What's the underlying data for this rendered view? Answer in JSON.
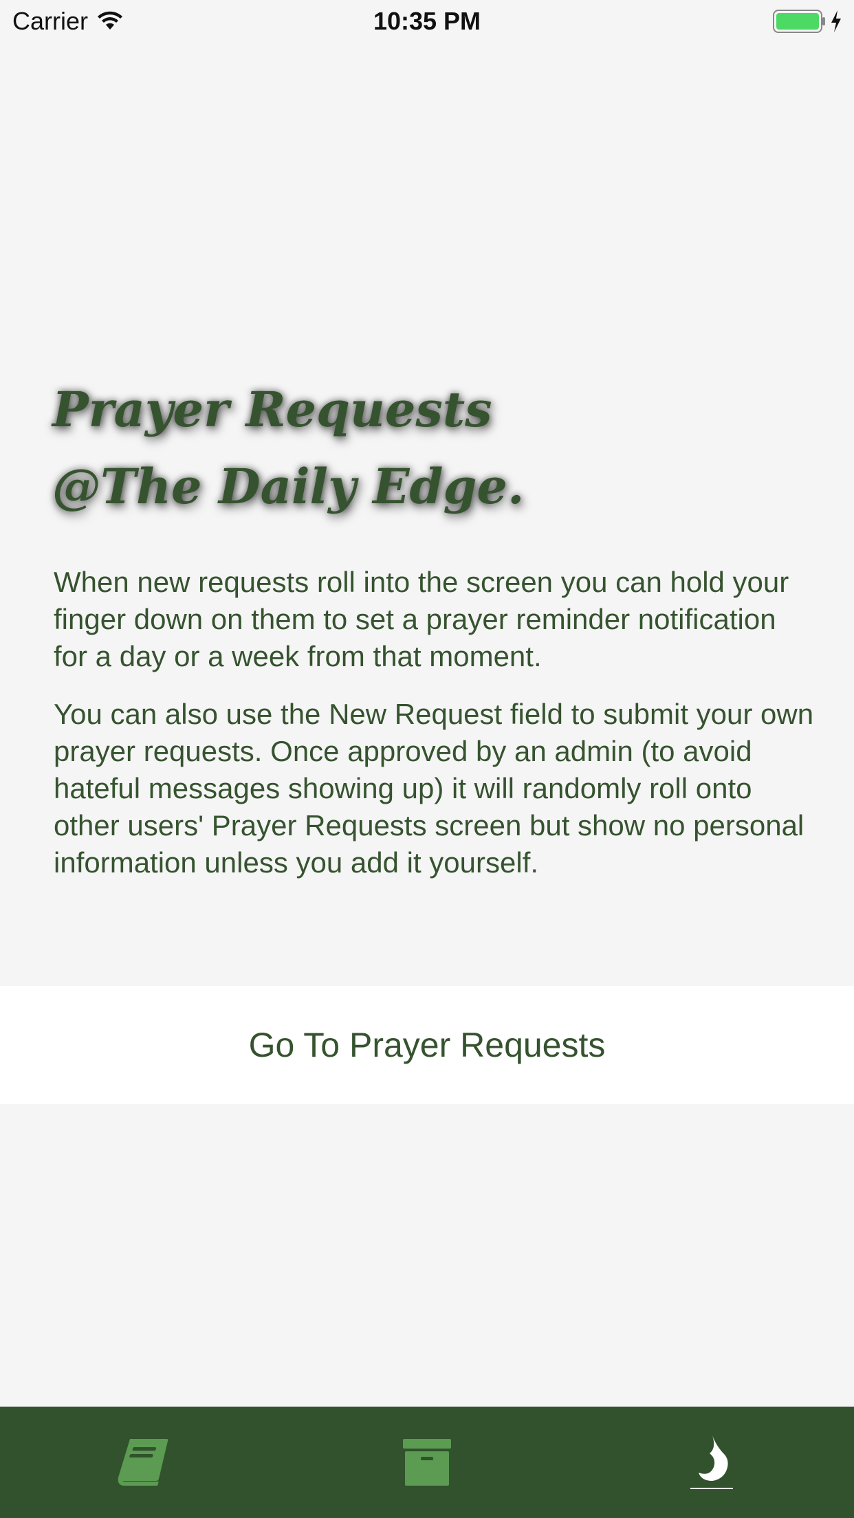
{
  "status_bar": {
    "carrier": "Carrier",
    "time": "10:35 PM",
    "battery_color": "#4cd964"
  },
  "header": {
    "title_line1": "Prayer Requests",
    "title_line2": "@The Daily Edge."
  },
  "body": {
    "paragraph1": "When new requests roll into the screen you can hold your finger down on them to set a prayer reminder notification for a day or a week from that moment.",
    "paragraph2": "You can also use the New Request field to submit your own prayer requests.  Once approved by an admin (to avoid hateful messages showing up) it will randomly roll onto other users' Prayer Requests screen but show no personal information unless you add it yourself."
  },
  "actions": {
    "go_button_label": "Go To Prayer Requests"
  },
  "tab_bar": {
    "background": "#32512d",
    "tabs": [
      {
        "icon": "book-icon",
        "color": "#5b9b52"
      },
      {
        "icon": "archive-box-icon",
        "color": "#5b9b52"
      },
      {
        "icon": "flame-icon",
        "color": "#ffffff",
        "selected": true
      }
    ]
  },
  "colors": {
    "accent_green": "#36532f",
    "background": "#f5f5f5"
  }
}
